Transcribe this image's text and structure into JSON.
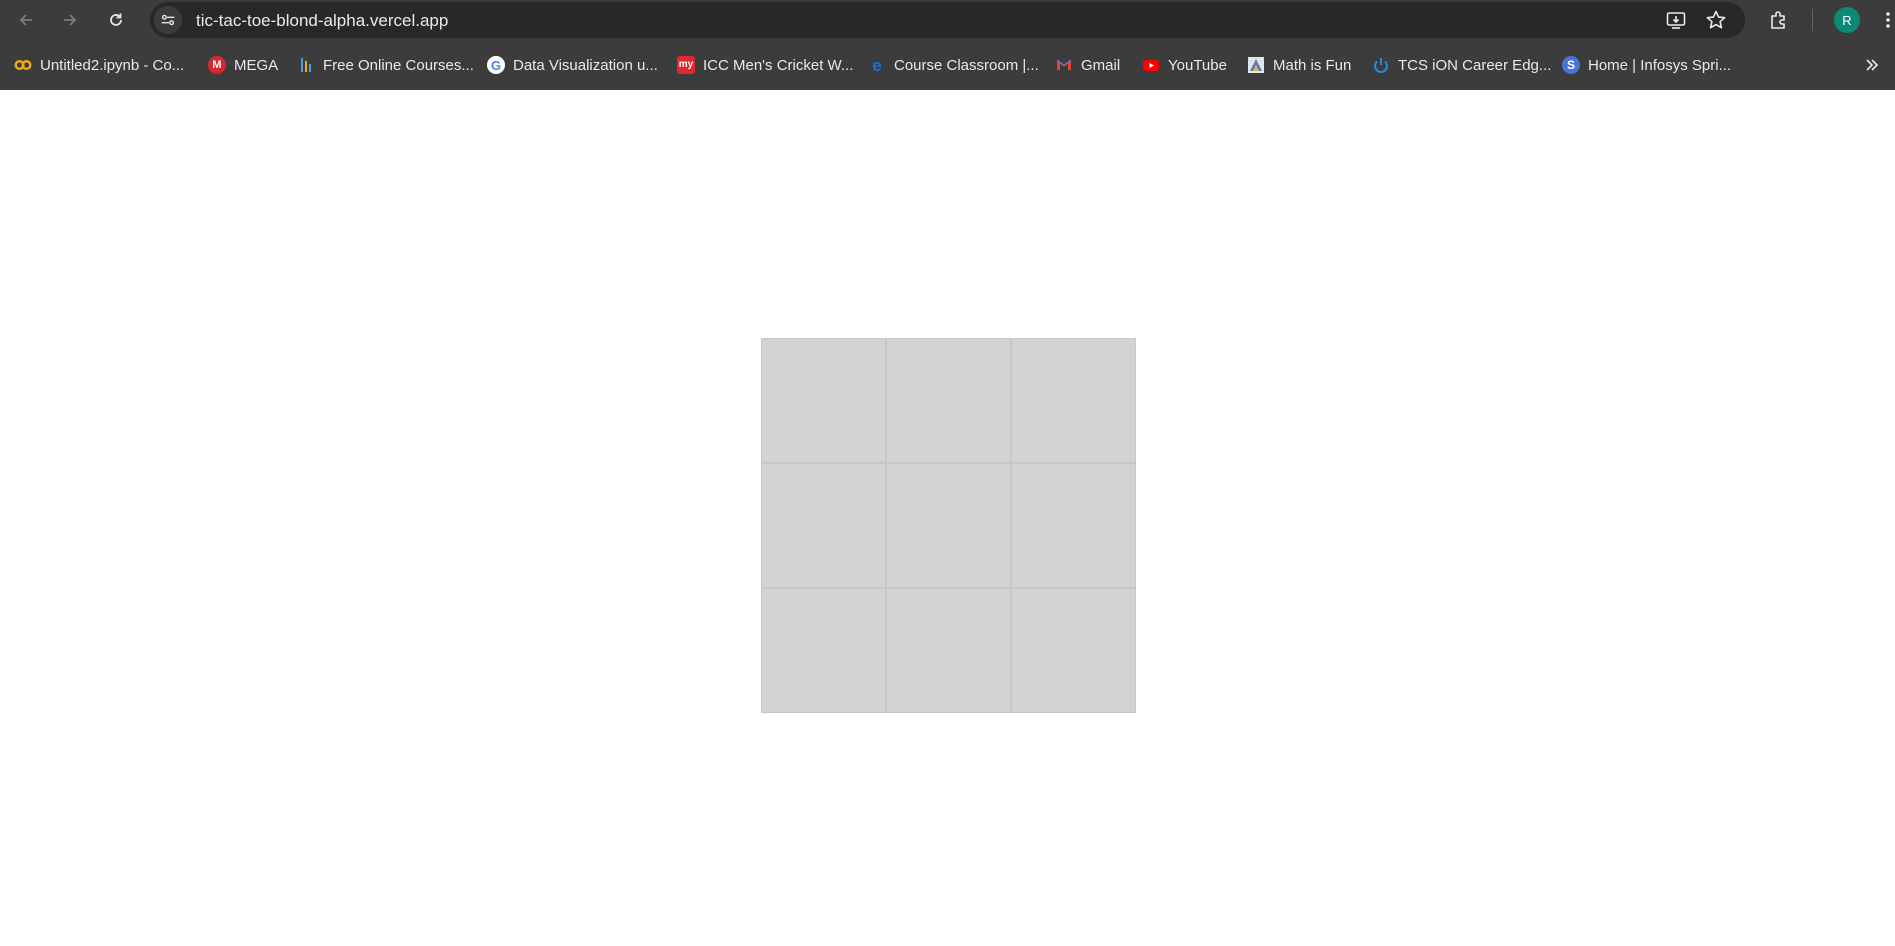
{
  "browser": {
    "url": "tic-tac-toe-blond-alpha.vercel.app",
    "profile_initial": "R",
    "accent_color": "#0b8a7a"
  },
  "bookmarks": [
    {
      "label": "Untitled2.ipynb - Co...",
      "icon": "colab-icon"
    },
    {
      "label": "MEGA",
      "icon": "mega-icon"
    },
    {
      "label": "Free Online Courses...",
      "icon": "courses-icon"
    },
    {
      "label": "Data Visualization u...",
      "icon": "google-icon"
    },
    {
      "label": "ICC Men's Cricket W...",
      "icon": "myntra-icon"
    },
    {
      "label": "Course Classroom |...",
      "icon": "course-icon"
    },
    {
      "label": "Gmail",
      "icon": "gmail-icon"
    },
    {
      "label": "YouTube",
      "icon": "youtube-icon"
    },
    {
      "label": "Math is Fun",
      "icon": "mathisfun-icon"
    },
    {
      "label": "TCS iON Career Edg...",
      "icon": "tcs-icon"
    },
    {
      "label": "Home | Infosys Spri...",
      "icon": "infosys-icon"
    }
  ],
  "game": {
    "board": [
      "",
      "",
      "",
      "",
      "",
      "",
      "",
      "",
      ""
    ],
    "cell_color": "#d3d3d3"
  }
}
